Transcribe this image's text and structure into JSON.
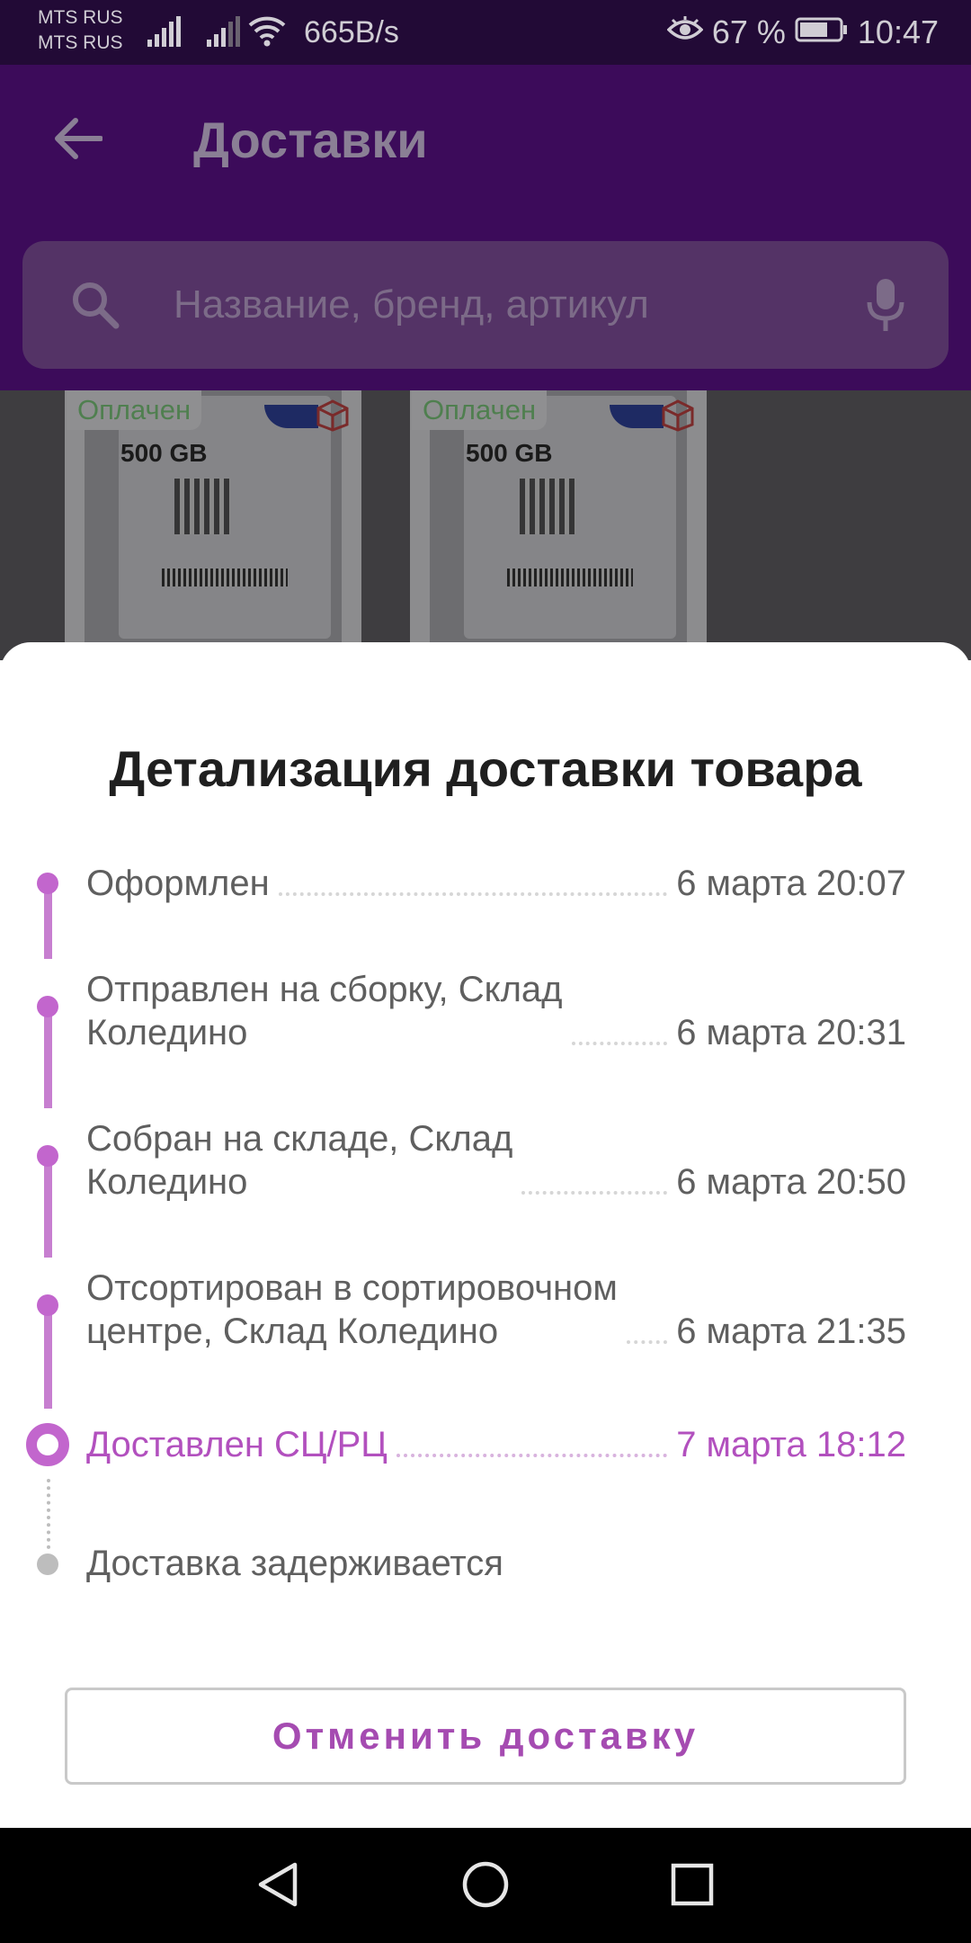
{
  "status_bar": {
    "carrier_1": "MTS RUS",
    "carrier_2": "MTS RUS",
    "net_speed": "665B/s",
    "battery_percent": "67 %",
    "time": "10:47",
    "icons": [
      "signal-icon",
      "signal-icon",
      "wifi-icon",
      "eye-comfort-icon",
      "battery-icon"
    ]
  },
  "header": {
    "title": "Доставки",
    "back_icon": "arrow-left-icon"
  },
  "search": {
    "placeholder": "Название, бренд, артикул",
    "icons": [
      "search-icon",
      "microphone-icon"
    ]
  },
  "product_cards": [
    {
      "status": "Оплачен",
      "capacity": "500 GB"
    },
    {
      "status": "Оплачен",
      "capacity": "500 GB"
    }
  ],
  "sheet": {
    "title": "Детализация доставки товара",
    "steps": [
      {
        "label": "Оформлен",
        "time": "6 марта 20:07",
        "state": "done"
      },
      {
        "label": "Отправлен на сборку, Склад\nКоледино",
        "time": "6 марта 20:31",
        "state": "done"
      },
      {
        "label": "Собран на складе, Склад\nКоледино",
        "time": "6 марта 20:50",
        "state": "done"
      },
      {
        "label": "Отсортирован в сортировочном\nцентре, Склад Коледино",
        "time": "6 марта 21:35",
        "state": "done"
      },
      {
        "label": "Доставлен СЦ/РЦ",
        "time": "7 марта 18:12",
        "state": "current"
      },
      {
        "label": "Доставка задерживается",
        "time": "",
        "state": "pending"
      }
    ],
    "cancel_label": "Отменить доставку"
  },
  "colors": {
    "accent": "#c266cd",
    "accent_text": "#a54bb1",
    "header_bg_dimmed": "#3c0b5a",
    "pending": "#bdbdbd"
  },
  "nav_bar": {
    "icons": [
      "back-triangle-icon",
      "home-circle-icon",
      "recents-square-icon"
    ]
  }
}
